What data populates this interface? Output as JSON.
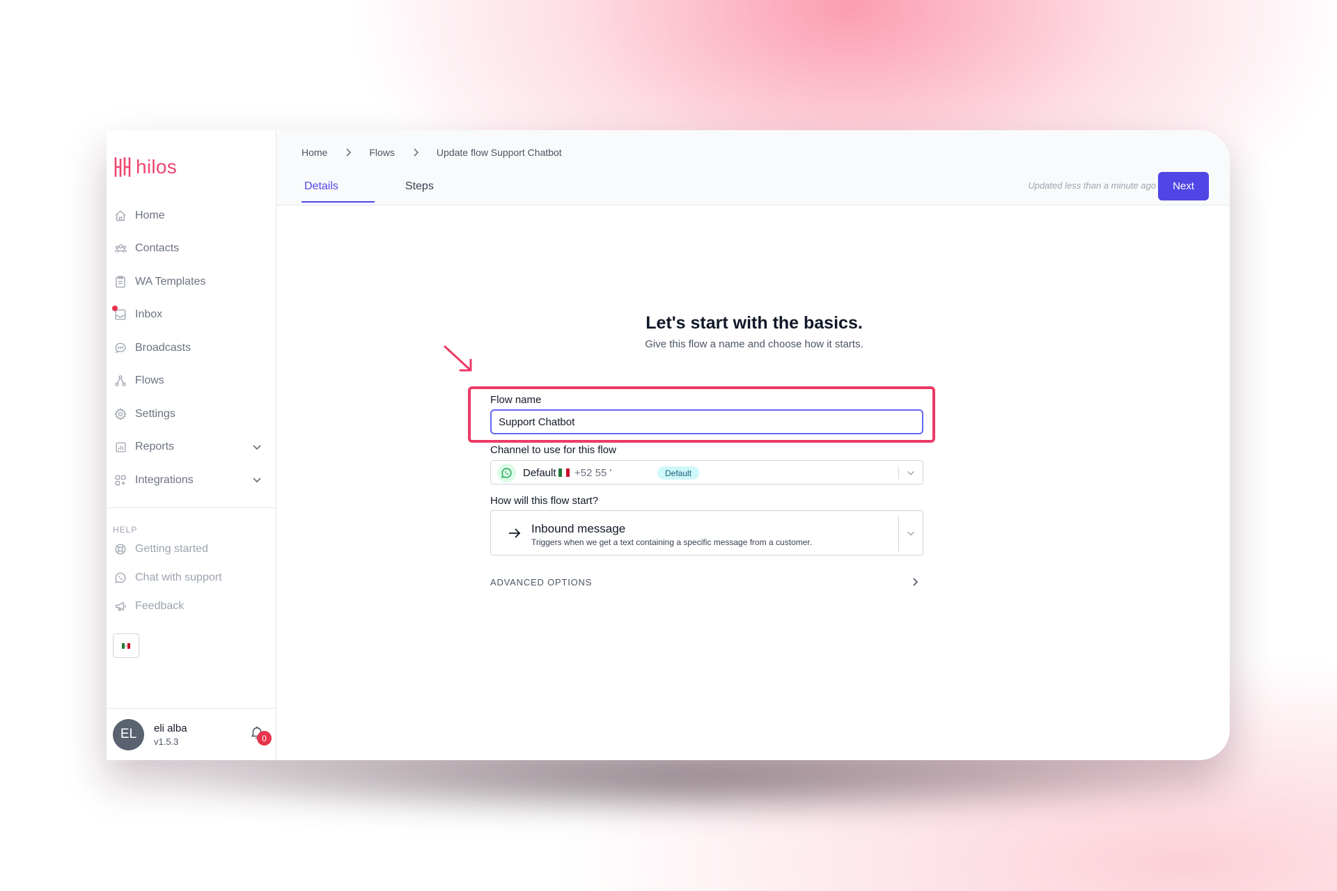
{
  "app": {
    "logo_text": "hilos",
    "accent": "#4f46e5",
    "brand": "#f0466e"
  },
  "sidebar": {
    "items": [
      {
        "label": "Home",
        "icon": "home-icon"
      },
      {
        "label": "Contacts",
        "icon": "users-icon"
      },
      {
        "label": "WA Templates",
        "icon": "clipboard-icon"
      },
      {
        "label": "Inbox",
        "icon": "inbox-icon",
        "unread_dot": true
      },
      {
        "label": "Broadcasts",
        "icon": "chat-bubble-icon"
      },
      {
        "label": "Flows",
        "icon": "flow-icon"
      },
      {
        "label": "Settings",
        "icon": "gear-icon"
      },
      {
        "label": "Reports",
        "icon": "chart-icon",
        "expandable": true
      },
      {
        "label": "Integrations",
        "icon": "grid-plus-icon",
        "expandable": true
      }
    ],
    "help_heading": "HELP",
    "help_items": [
      {
        "label": "Getting started",
        "icon": "lifebuoy-icon"
      },
      {
        "label": "Chat with support",
        "icon": "whatsapp-icon"
      },
      {
        "label": "Feedback",
        "icon": "megaphone-icon"
      }
    ],
    "language_flag": "mexico-flag-icon",
    "user": {
      "initials": "EL",
      "name": "eli alba",
      "version": "v1.5.3",
      "notifications": "0"
    }
  },
  "header": {
    "breadcrumb": [
      "Home",
      "Flows",
      "Update flow Support Chatbot"
    ],
    "tabs": [
      {
        "label": "Details",
        "active": true
      },
      {
        "label": "Steps",
        "active": false
      }
    ],
    "updated_text": "Updated less than a minute ago",
    "next_label": "Next"
  },
  "form": {
    "title": "Let's start with the basics.",
    "subtitle": "Give this flow a name and choose how it starts.",
    "flow_name_label": "Flow name",
    "flow_name_value": "Support Chatbot",
    "channel_label": "Channel to use for this flow",
    "channel": {
      "name": "Default",
      "phone": "+52 55 '",
      "badge": "Default"
    },
    "start_label": "How will this flow start?",
    "trigger": {
      "title": "Inbound message",
      "description": "Triggers when we get a text containing a specific message from a customer."
    },
    "advanced_label": "ADVANCED OPTIONS"
  }
}
